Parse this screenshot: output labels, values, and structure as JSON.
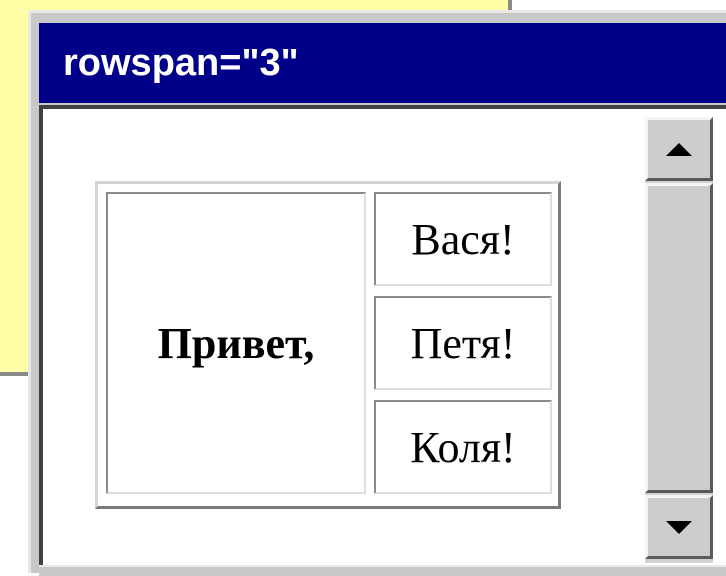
{
  "window": {
    "title": "rowspan=\"3\""
  },
  "table": {
    "main_cell": "Привет,",
    "rows": [
      "Вася!",
      "Петя!",
      "Коля!"
    ]
  },
  "scrollbar": {
    "up_icon": "arrow-up-icon",
    "down_icon": "arrow-down-icon"
  },
  "colors": {
    "titlebar": "#000088",
    "note_background": "#fffea6",
    "chrome": "#c8c8c8"
  }
}
